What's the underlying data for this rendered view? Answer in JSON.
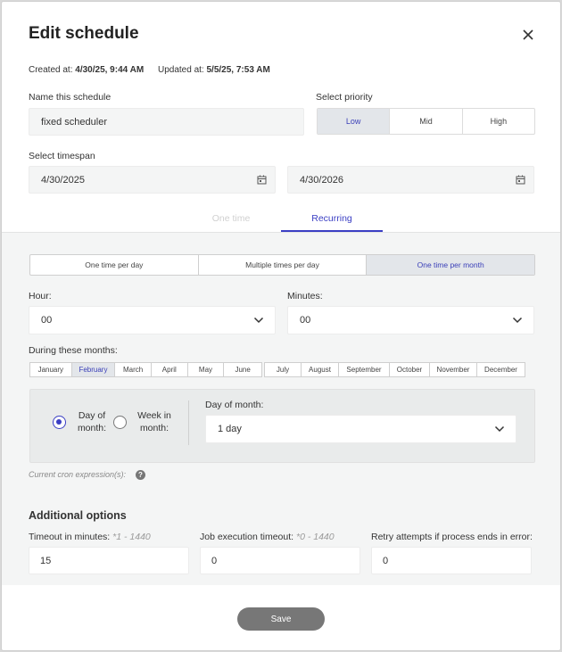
{
  "header": {
    "title": "Edit schedule"
  },
  "meta": {
    "created_label": "Created at:",
    "created_value": "4/30/25, 9:44 AM",
    "updated_label": "Updated at:",
    "updated_value": "5/5/25, 7:53 AM"
  },
  "name_field": {
    "label": "Name this schedule",
    "value": "fixed scheduler"
  },
  "priority": {
    "label": "Select priority",
    "options": [
      "Low",
      "Mid",
      "High"
    ],
    "selected": "Low"
  },
  "timespan": {
    "label": "Select timespan",
    "start": "4/30/2025",
    "end": "4/30/2026"
  },
  "tabs": {
    "one_time": "One time",
    "recurring": "Recurring",
    "active": "Recurring"
  },
  "frequency": {
    "options": [
      "One time per day",
      "Multiple times per day",
      "One time per month"
    ],
    "selected": "One time per month"
  },
  "hour": {
    "label": "Hour:",
    "value": "00"
  },
  "minutes": {
    "label": "Minutes:",
    "value": "00"
  },
  "months": {
    "label": "During these months:",
    "group1": [
      "January",
      "February",
      "March",
      "April",
      "May",
      "June"
    ],
    "group2": [
      "July",
      "August",
      "September",
      "October",
      "November",
      "December"
    ],
    "selected": "February"
  },
  "day_mode": {
    "day_of_month_line1": "Day of",
    "day_of_month_line2": "month:",
    "week_in_month_line1": "Week in",
    "week_in_month_line2": "month:",
    "selected": "day_of_month"
  },
  "day_of_month": {
    "label": "Day of month:",
    "value": "1 day"
  },
  "cron": {
    "label": "Current cron expression(s):"
  },
  "additional": {
    "title": "Additional options",
    "timeout_label": "Timeout in minutes:",
    "timeout_hint": "*1 - 1440",
    "timeout_value": "15",
    "job_timeout_label": "Job execution timeout:",
    "job_timeout_hint": "*0 - 1440",
    "job_timeout_value": "0",
    "retry_label": "Retry attempts if process ends in error:",
    "retry_value": "0"
  },
  "footer": {
    "save_label": "Save"
  },
  "colors": {
    "accent": "#3b3fc4",
    "selected_bg": "#e3e6ea",
    "save_bg": "#777777"
  },
  "icons": [
    "close-icon",
    "calendar-icon",
    "chevron-down-icon",
    "help-icon"
  ]
}
